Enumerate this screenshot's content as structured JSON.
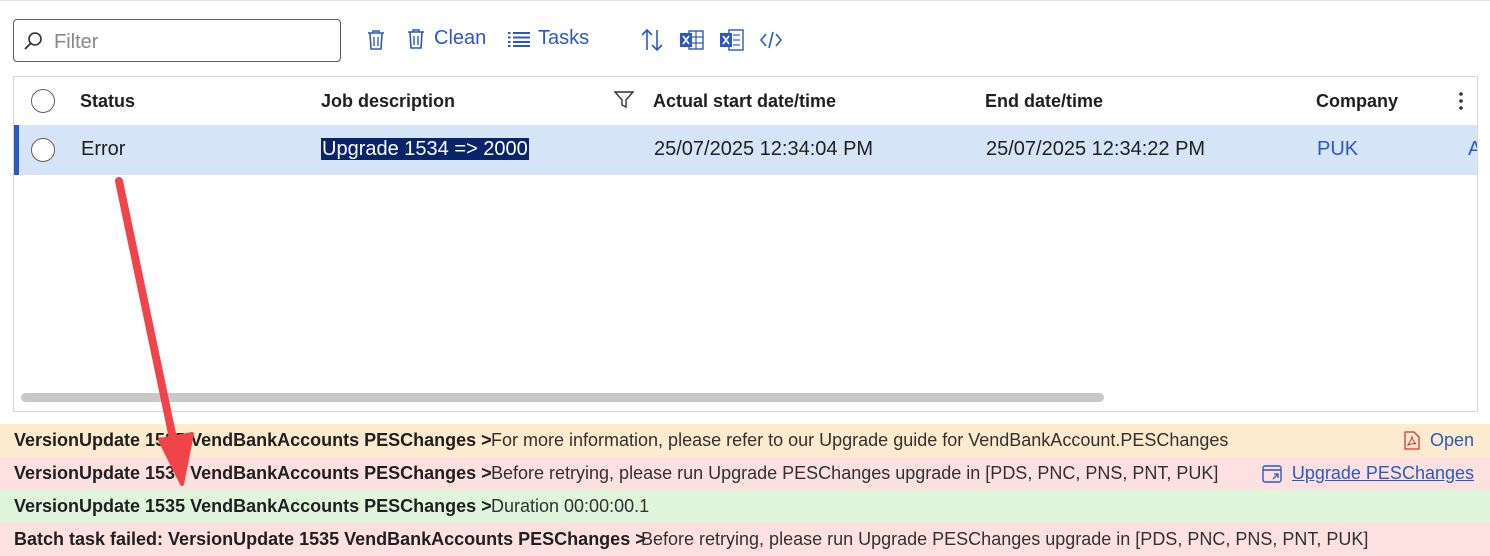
{
  "filter": {
    "placeholder": "Filter",
    "value": ""
  },
  "toolbar": {
    "clean_label": "Clean",
    "tasks_label": "Tasks",
    "icons": [
      "delete-icon",
      "clean-icon",
      "tasks-list-icon",
      "sort-icon",
      "excel-icon",
      "word-icon",
      "code-icon"
    ]
  },
  "grid": {
    "columns": [
      "Status",
      "Job description",
      "Actual start date/time",
      "End date/time",
      "Company"
    ],
    "rows": [
      {
        "status": "Error",
        "job_description": "Upgrade 1534 => 2000",
        "start": "25/07/2025 12:34:04 PM",
        "end": "25/07/2025 12:34:22 PM",
        "company": "PUK",
        "next_cell_fragment": "A"
      }
    ]
  },
  "messages": [
    {
      "source": "VersionUpdate 1535 VendBankAccounts PESChanges >",
      "text": "For more information, please refer to our Upgrade guide for VendBankAccount.PESChanges",
      "action": "Open",
      "action_icon": "pdf-icon",
      "color": "#fdebd0"
    },
    {
      "source": "VersionUpdate 1535 VendBankAccounts PESChanges >",
      "text": "Before retrying, please run Upgrade PESChanges upgrade in [PDS, PNC, PNS, PNT, PUK]",
      "action": "Upgrade PESChanges",
      "action_icon": "open-form-icon",
      "color": "#fde1e1"
    },
    {
      "source": "VersionUpdate 1535 VendBankAccounts PESChanges >",
      "text": "Duration 00:00:00.1",
      "color": "#dff6dd"
    },
    {
      "source": "Batch task failed: VersionUpdate 1535 VendBankAccounts PESChanges >",
      "text": "Before retrying, please run Upgrade PESChanges upgrade in [PDS, PNC, PNS, PNT, PUK]",
      "color": "#fde1e1"
    }
  ],
  "colors": {
    "accent": "#2b59c3",
    "selected_row": "#d6e4f7",
    "annotation_arrow": "#f0444a"
  }
}
